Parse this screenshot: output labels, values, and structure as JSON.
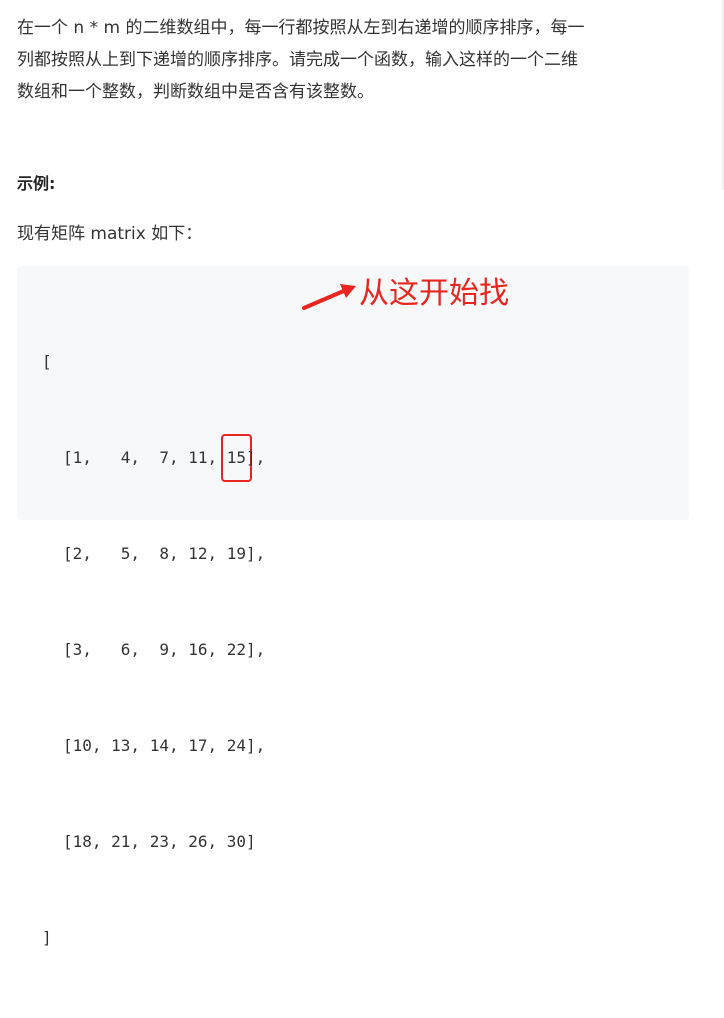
{
  "description": {
    "lines": [
      "在一个 n * m 的二维数组中，每一行都按照从左到右递增的顺序排序，每一",
      "列都按照从上到下递增的顺序排序。请完成一个函数，输入这样的一个二维",
      "数组和一个整数，判断数组中是否含有该整数。"
    ]
  },
  "example": {
    "heading": "示例:",
    "intro": "现有矩阵 matrix 如下："
  },
  "matrix": {
    "open_bracket": "[",
    "close_bracket": "]",
    "rows": [
      [
        "[1,   4,  7, 11, ",
        "15",
        "],"
      ],
      [
        "[2,   5,  8, 12, 19],"
      ],
      [
        "[3,   6,  9, 16, 22],"
      ],
      [
        "[10, 13, 14, 17, 24],"
      ],
      [
        "[18, 21, 23, 26, 30]"
      ]
    ]
  },
  "annotation": {
    "text": "从这开始找",
    "color": "#e8261f"
  }
}
